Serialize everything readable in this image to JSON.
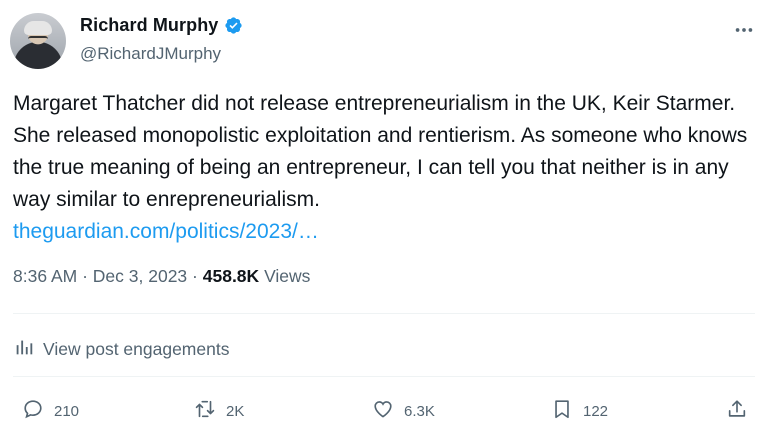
{
  "author": {
    "name": "Richard Murphy",
    "handle": "@RichardJMurphy",
    "verified": true
  },
  "tweet": {
    "text": "Margaret Thatcher did not release entrepreneurialism in the UK, Keir Starmer. She released monopolistic exploitation and rentierism. As someone who knows the true meaning of being an entrepreneur, I can tell you that neither is in any way similar to enrepreneurialism.",
    "link": "theguardian.com/politics/2023/…"
  },
  "meta": {
    "time": "8:36 AM",
    "separator": "·",
    "date": "Dec 3, 2023",
    "views_count": "458.8K",
    "views_label": "Views"
  },
  "engagements": {
    "label": "View post engagements"
  },
  "actions": {
    "replies": "210",
    "reposts": "2K",
    "likes": "6.3K",
    "bookmarks": "122"
  },
  "icons": {
    "verified": "verified-badge-icon",
    "more": "more-dots-icon",
    "engagements": "bar-chart-icon",
    "reply": "reply-icon",
    "repost": "repost-icon",
    "like": "heart-icon",
    "bookmark": "bookmark-icon",
    "share": "share-icon"
  },
  "colors": {
    "accent": "#1d9bf0",
    "text": "#0f1419",
    "secondary": "#536471",
    "divider": "#eff3f4"
  }
}
